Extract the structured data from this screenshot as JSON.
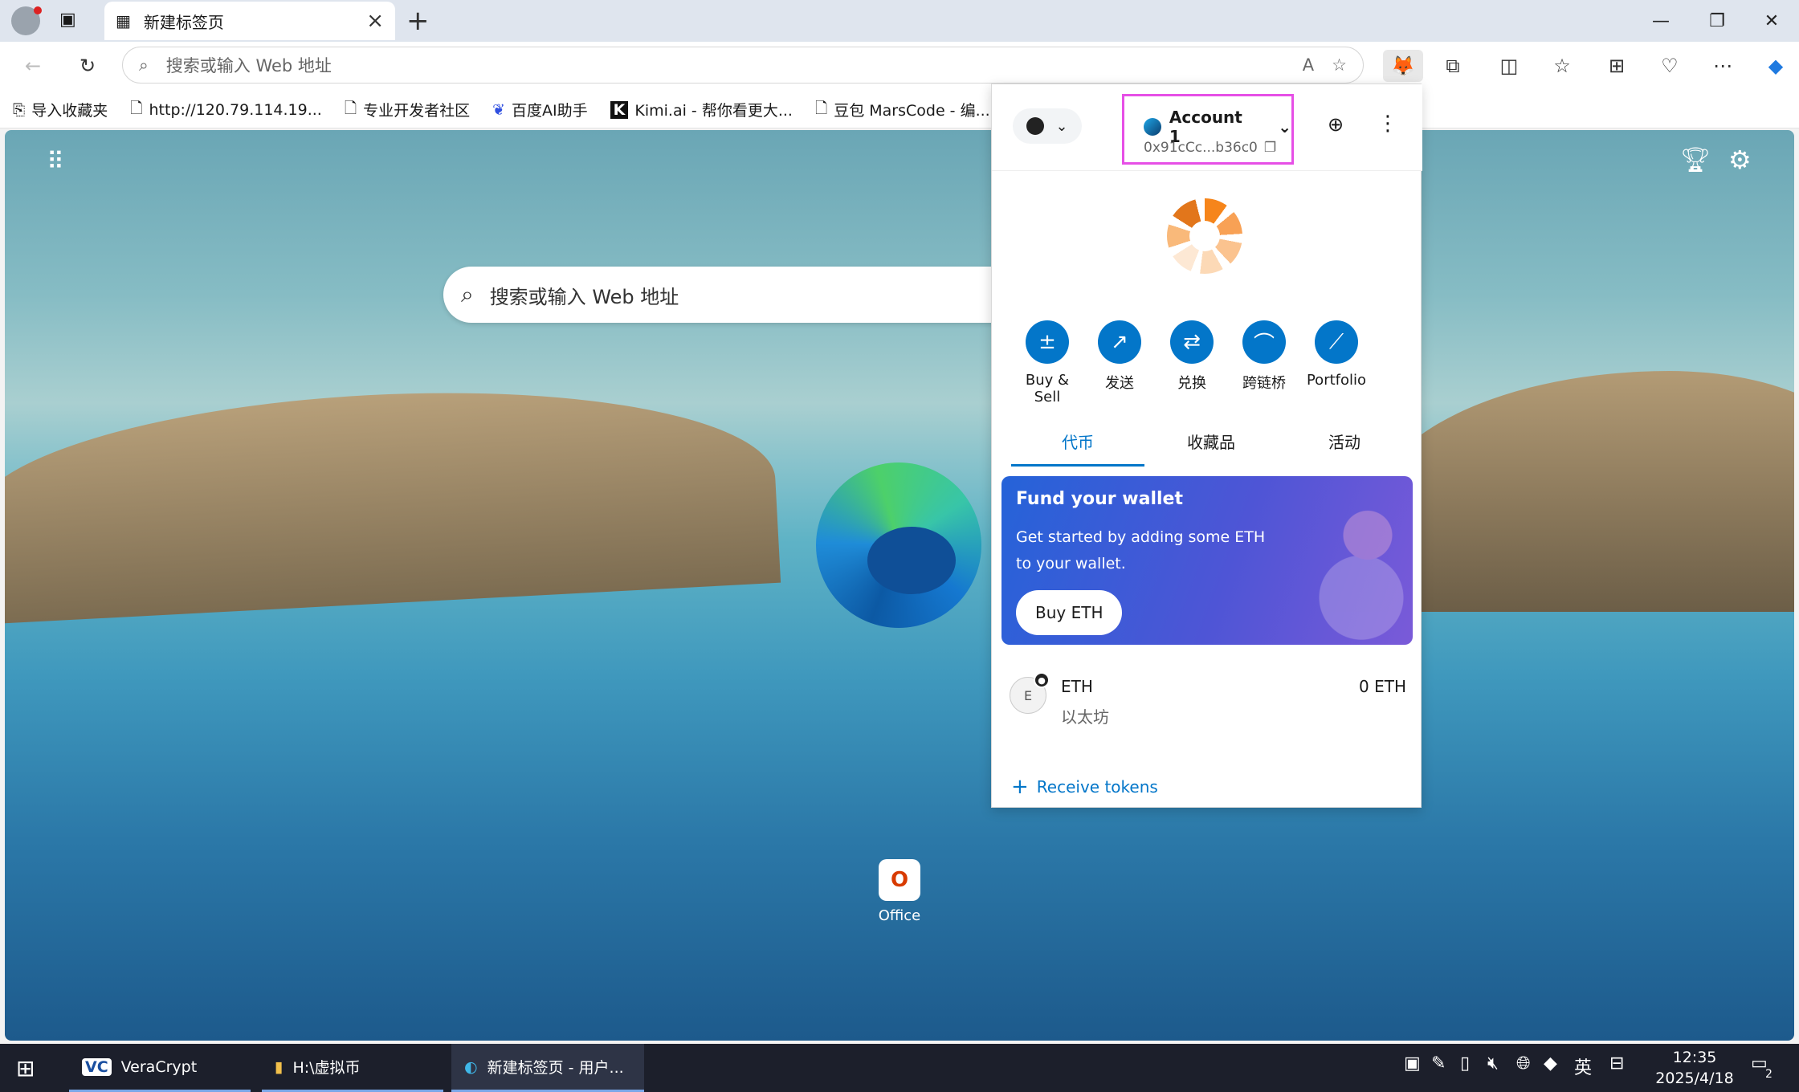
{
  "browser": {
    "tab_title": "新建标签页",
    "omnibox_placeholder": "搜索或输入 Web 地址",
    "bookmarks": [
      "导入收藏夹",
      "http://120.79.114.19...",
      "专业开发者社区",
      "百度AI助手",
      "Kimi.ai - 帮你看更大...",
      "豆包 MarsCode - 编..."
    ]
  },
  "ntp": {
    "search_placeholder": "搜索或输入 Web 地址",
    "office_label": "Office"
  },
  "wallet": {
    "account_name": "Account 1",
    "account_address": "0x91cCc...b36c0",
    "actions": [
      "Buy & Sell",
      "发送",
      "兑换",
      "跨链桥",
      "Portfolio"
    ],
    "tabs": [
      "代币",
      "收藏品",
      "活动"
    ],
    "active_tab": "代币",
    "fund_title": "Fund your wallet",
    "fund_body": "Get started by adding some ETH to your wallet.",
    "fund_button": "Buy ETH",
    "token_symbol": "ETH",
    "token_name": "以太坊",
    "token_balance": "0 ETH",
    "token_avatar_letter": "E",
    "receive_label": "Receive tokens"
  },
  "taskbar": {
    "items": [
      "VeraCrypt",
      "H:\\虚拟币",
      "新建标签页 - 用户..."
    ],
    "ime": "英",
    "time": "12:35",
    "date": "2025/4/18",
    "notification_count": "2"
  }
}
